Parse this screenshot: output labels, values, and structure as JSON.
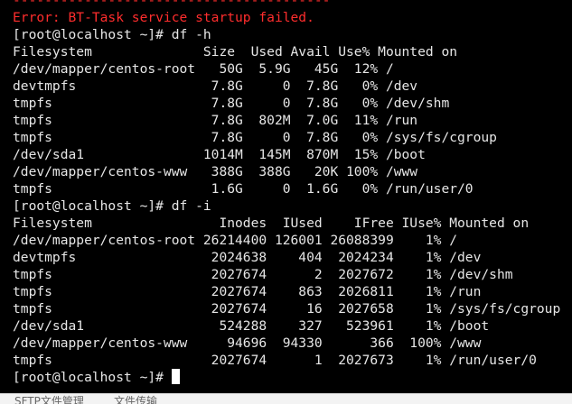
{
  "terminal": {
    "lines": [
      {
        "text": "----------------------------------------",
        "style": "err"
      },
      {
        "text": "Error: BT-Task service startup failed.",
        "style": "err"
      },
      {
        "text": "[root@localhost ~]# df -h",
        "style": "normal"
      },
      {
        "text": "Filesystem              Size  Used Avail Use% Mounted on",
        "style": "normal"
      },
      {
        "text": "/dev/mapper/centos-root   50G  5.9G   45G  12% /",
        "style": "normal"
      },
      {
        "text": "devtmpfs                 7.8G     0  7.8G   0% /dev",
        "style": "normal"
      },
      {
        "text": "tmpfs                    7.8G     0  7.8G   0% /dev/shm",
        "style": "normal"
      },
      {
        "text": "tmpfs                    7.8G  802M  7.0G  11% /run",
        "style": "normal"
      },
      {
        "text": "tmpfs                    7.8G     0  7.8G   0% /sys/fs/cgroup",
        "style": "normal"
      },
      {
        "text": "/dev/sda1               1014M  145M  870M  15% /boot",
        "style": "normal"
      },
      {
        "text": "/dev/mapper/centos-www   388G  388G   20K 100% /www",
        "style": "normal"
      },
      {
        "text": "tmpfs                    1.6G     0  1.6G   0% /run/user/0",
        "style": "normal"
      },
      {
        "text": "[root@localhost ~]# df -i",
        "style": "normal"
      },
      {
        "text": "Filesystem                Inodes  IUsed    IFree IUse% Mounted on",
        "style": "normal"
      },
      {
        "text": "/dev/mapper/centos-root 26214400 126001 26088399    1% /",
        "style": "normal"
      },
      {
        "text": "devtmpfs                 2024638    404  2024234    1% /dev",
        "style": "normal"
      },
      {
        "text": "tmpfs                    2027674      2  2027672    1% /dev/shm",
        "style": "normal"
      },
      {
        "text": "tmpfs                    2027674    863  2026811    1% /run",
        "style": "normal"
      },
      {
        "text": "tmpfs                    2027674     16  2027658    1% /sys/fs/cgroup",
        "style": "normal"
      },
      {
        "text": "/dev/sda1                 524288    327   523961    1% /boot",
        "style": "normal"
      },
      {
        "text": "/dev/mapper/centos-www     94696  94330      366  100% /www",
        "style": "normal"
      },
      {
        "text": "tmpfs                    2027674      1  2027673    1% /run/user/0",
        "style": "normal"
      },
      {
        "text": "[root@localhost ~]# ",
        "style": "prompt"
      }
    ]
  },
  "bottom_tabs": [
    {
      "label": "SFTP文件管理"
    },
    {
      "label": "文件传输"
    }
  ],
  "colors": {
    "background": "#000000",
    "text": "#e6e6e6",
    "error": "#ff2d2d",
    "cursor": "#ffffff"
  }
}
